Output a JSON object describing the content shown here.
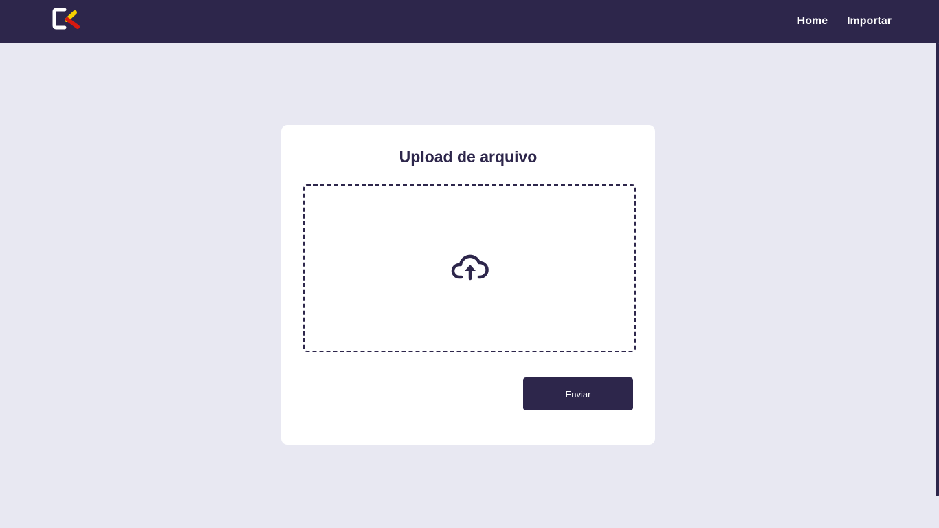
{
  "navbar": {
    "logo_icon": "logo-icon",
    "links": [
      {
        "label": "Home"
      },
      {
        "label": "Importar"
      }
    ]
  },
  "upload_card": {
    "title": "Upload de arquivo",
    "dropzone_icon": "cloud-upload-icon",
    "submit_label": "Enviar"
  },
  "colors": {
    "primary": "#2d264b",
    "background": "#e8e8f2",
    "card": "#ffffff",
    "logo_yellow": "#f5d000",
    "logo_red": "#d7190f"
  }
}
